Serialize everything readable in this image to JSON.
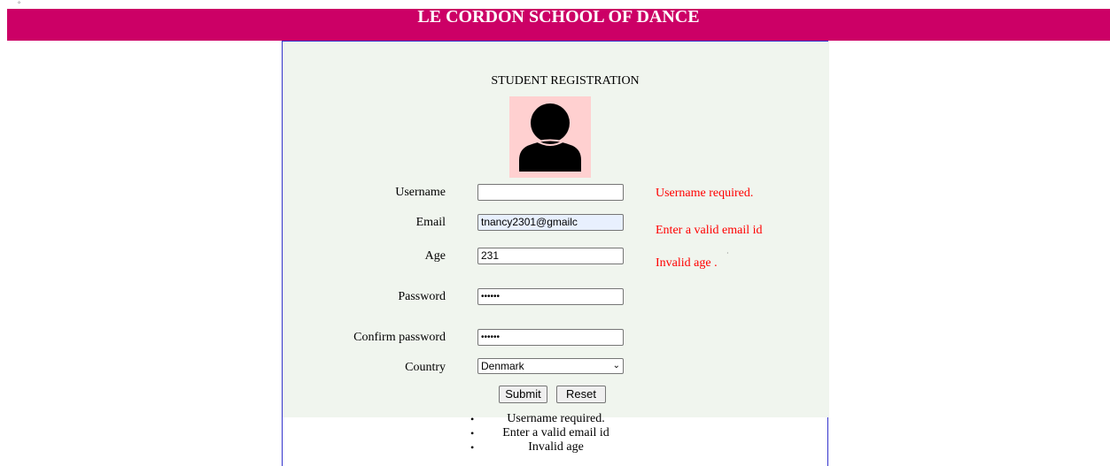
{
  "header": {
    "title": "LE CORDON SCHOOL OF DANCE"
  },
  "form": {
    "title": "STUDENT REGISTRATION",
    "avatar_icon": "user-silhouette-icon",
    "fields": {
      "username": {
        "label": "Username",
        "value": "",
        "error": "Username required."
      },
      "email": {
        "label": "Email",
        "value": "tnancy2301@gmailc",
        "error": "Enter a valid email id"
      },
      "age": {
        "label": "Age",
        "value": "231",
        "error": "Invalid age ."
      },
      "password": {
        "label": "Password",
        "value": "••••••"
      },
      "confirm_password": {
        "label": "Confirm password",
        "value": "••••••"
      },
      "country": {
        "label": "Country",
        "value": "Denmark"
      }
    },
    "buttons": {
      "submit": "Submit",
      "reset": "Reset"
    }
  },
  "summary": [
    "Username required.",
    "Enter a valid email id",
    "Invalid age"
  ],
  "colors": {
    "banner": "#cc0066",
    "panel": "#f0f5ee",
    "error": "#ff0000",
    "avatar_bg": "#ffd0d0"
  }
}
